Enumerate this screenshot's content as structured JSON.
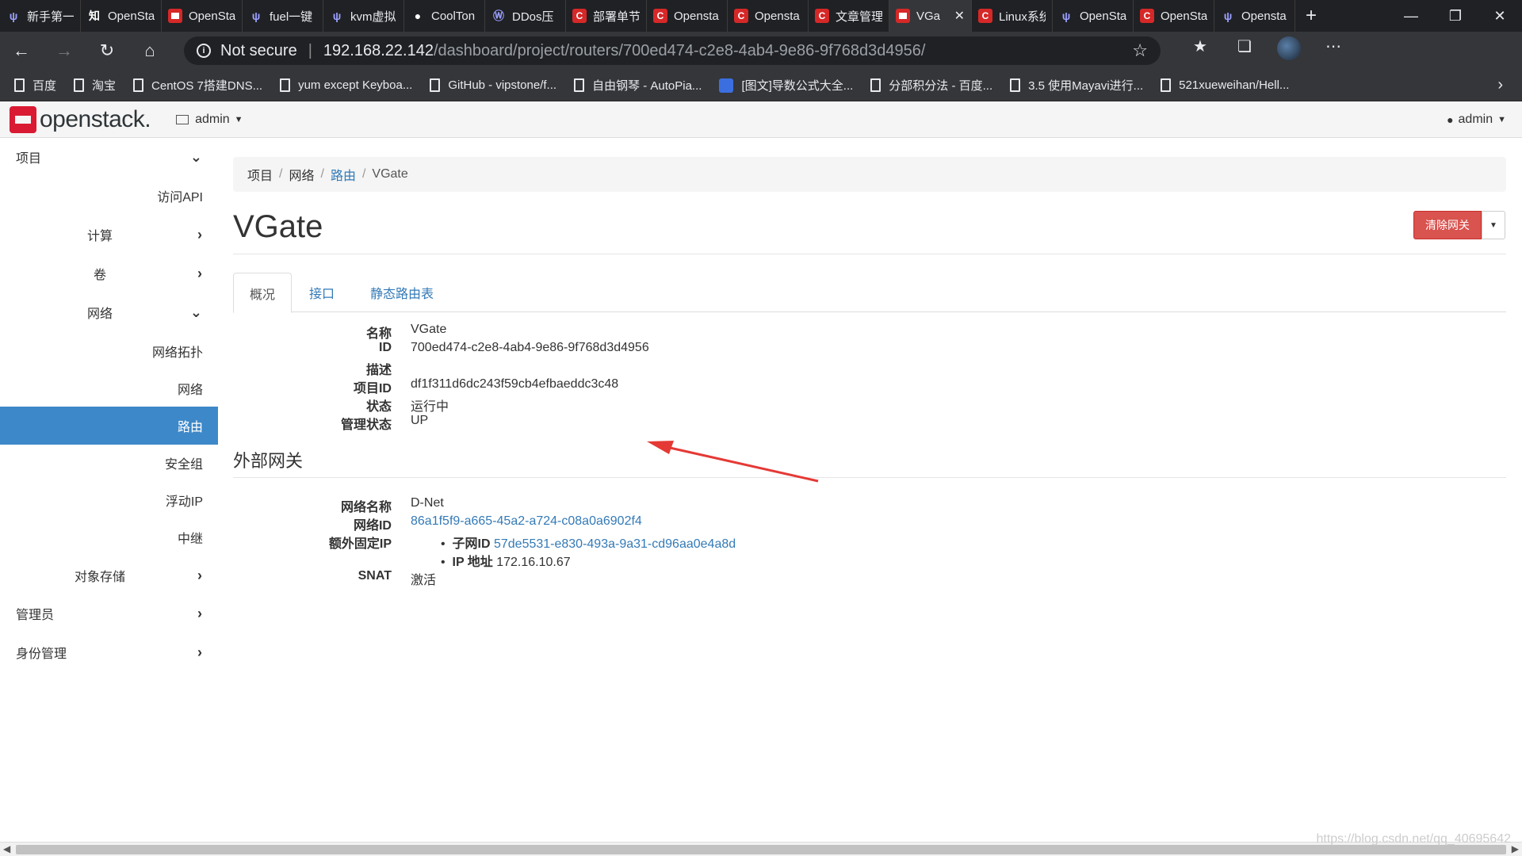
{
  "browser": {
    "tabs": [
      {
        "label": "新手第一",
        "icon": "w"
      },
      {
        "label": "OpenSta",
        "icon": "zhi"
      },
      {
        "label": "OpenSta",
        "icon": "os"
      },
      {
        "label": "fuel一键",
        "icon": "w"
      },
      {
        "label": "kvm虚拟",
        "icon": "w"
      },
      {
        "label": "CoolTon",
        "icon": "gh"
      },
      {
        "label": "DDos压",
        "icon": "wp"
      },
      {
        "label": "部署单节",
        "icon": "c"
      },
      {
        "label": "Opensta",
        "icon": "c"
      },
      {
        "label": "Opensta",
        "icon": "c"
      },
      {
        "label": "文章管理",
        "icon": "c"
      },
      {
        "label": "VGa",
        "icon": "os",
        "active": true
      },
      {
        "label": "Linux系统",
        "icon": "c"
      },
      {
        "label": "OpenSta",
        "icon": "w"
      },
      {
        "label": "OpenSta",
        "icon": "c"
      },
      {
        "label": "Opensta",
        "icon": "w"
      }
    ],
    "not_secure": "Not secure",
    "url_host": "192.168.22.142",
    "url_path": "/dashboard/project/routers/700ed474-c2e8-4ab4-9e86-9f768d3d4956/",
    "bookmarks": [
      "百度",
      "淘宝",
      "CentOS 7搭建DNS...",
      "yum except Keyboa...",
      "GitHub - vipstone/f...",
      "自由钢琴 - AutoPia...",
      "[图文]导数公式大全...",
      "分部积分法 - 百度...",
      "3.5 使用Mayavi进行...",
      "521xueweihan/Hell..."
    ]
  },
  "header": {
    "logo": "openstack.",
    "project": "admin",
    "user": "admin"
  },
  "sidebar": {
    "project": "项目",
    "access_api": "访问API",
    "compute": "计算",
    "volumes": "卷",
    "network": "网络",
    "network_topology": "网络拓扑",
    "networks": "网络",
    "routers": "路由",
    "security_groups": "安全组",
    "floating_ips": "浮动IP",
    "relay": "中继",
    "object_store": "对象存储",
    "admin": "管理员",
    "identity": "身份管理"
  },
  "breadcrumb": {
    "project": "项目",
    "network": "网络",
    "routers": "路由",
    "current": "VGate"
  },
  "page": {
    "title": "VGate",
    "clear_gateway": "清除网关",
    "tabs": {
      "overview": "概况",
      "interfaces": "接口",
      "static_routes": "静态路由表"
    }
  },
  "overview": {
    "name_label": "名称",
    "name": "VGate",
    "id_label": "ID",
    "id": "700ed474-c2e8-4ab4-9e86-9f768d3d4956",
    "desc_label": "描述",
    "project_id_label": "项目ID",
    "project_id": "df1f311d6dc243f59cb4efbaeddc3c48",
    "status_label": "状态",
    "status": "运行中",
    "admin_state_label": "管理状态",
    "admin_state": "UP"
  },
  "gateway": {
    "section_title": "外部网关",
    "net_name_label": "网络名称",
    "net_name": "D-Net",
    "net_id_label": "网络ID",
    "net_id": "86a1f5f9-a665-45a2-a724-c08a0a6902f4",
    "fixed_ip_label": "额外固定IP",
    "subnet_id_label": "子网ID",
    "subnet_id": "57de5531-e830-493a-9a31-cd96aa0e4a8d",
    "ip_label": "IP 地址",
    "ip": "172.16.10.67",
    "snat_label": "SNAT",
    "snat": "激活"
  },
  "watermark": "https://blog.csdn.net/qq_40695642",
  "colors": {
    "accent": "#3d88c9",
    "danger": "#d9534f",
    "link": "#337ab7",
    "annotation": "#e53935"
  }
}
